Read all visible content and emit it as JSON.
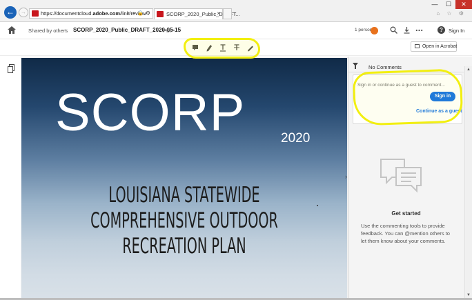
{
  "browser": {
    "url_prefix": "https://documentcloud.",
    "url_domain": "adobe.com",
    "url_path": "/link/review/?",
    "url_controls": "⌕ ▾ 🔒 C",
    "tab_title": "SCORP_2020_Public_DRAFT...",
    "tab_close": "×",
    "minimize": "—",
    "maximize": "☐",
    "close": "✕",
    "ie_icons": "⌂ ☆ ⚙"
  },
  "header": {
    "breadcrumb": "Shared by others",
    "breadcrumb_sep": "›",
    "document_title": "SCORP_2020_Public_DRAFT_2020-05-15",
    "doc_sep": "·",
    "document_type": "PDF",
    "people": "1 person",
    "help": "?",
    "sign_in": "Sign In"
  },
  "toolbar": {
    "open_in_acrobat": "Open in Acrobat"
  },
  "document": {
    "title_word": "SCORP",
    "title_year": "2020",
    "subtitle_lines": [
      "LOUISIANA STATEWIDE",
      "COMPREHENSIVE OUTDOOR",
      "RECREATION PLAN"
    ]
  },
  "comments": {
    "header": "No Comments",
    "input_placeholder": "Sign in or continue as a guest to comment...",
    "sign_in_button": "Sign in",
    "continue_as_guest": "Continue as a guest",
    "empty_title": "Get started",
    "empty_hint": "Use the commenting tools to provide feedback. You can @mention others to let them know about your comments."
  },
  "colors": {
    "accent_blue": "#1473e6",
    "highlighter_yellow": "#f2ef10",
    "people_badge": "#e8711c",
    "adobe_red": "#c8161d"
  }
}
